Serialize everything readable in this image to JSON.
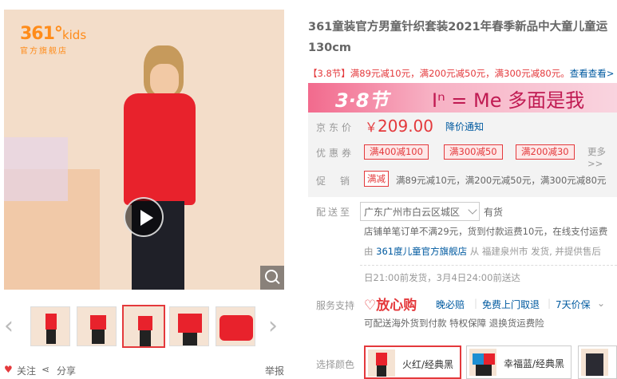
{
  "brand": {
    "logo_main": "361°",
    "logo_kids": "kids",
    "logo_sub": "官方旗舰店"
  },
  "gallery": {
    "prev_arrow": "‹",
    "next_arrow": "›",
    "thumbnails": [
      "thumb-1",
      "thumb-2",
      "thumb-3",
      "thumb-4",
      "thumb-5"
    ],
    "active_index": 2
  },
  "actions": {
    "follow": "关注",
    "share": "分享",
    "report": "举报"
  },
  "product": {
    "title": "361童装官方男童针织套装2021年春季新品中大童儿童运",
    "title_line2": "130cm",
    "promo_tag": "【3.8节】",
    "promo_text": "满89元减10元，满200元减50元，满300元减80元。",
    "promo_link": "查看查看>"
  },
  "banner": {
    "festival": "3·8节",
    "slogan": "Iⁿ = Me 多面是我"
  },
  "price": {
    "label": "京东价",
    "currency": "￥",
    "value": "209.00",
    "notice": "降价通知"
  },
  "coupons": {
    "label": "优惠券",
    "items": [
      "满400减100",
      "满300减50",
      "满200减30"
    ],
    "more": "更多>>"
  },
  "promotion": {
    "label": "促销",
    "tag": "满减",
    "text": "满89元减10元，满200元减50元，满300元减80元"
  },
  "shipping": {
    "label": "配送至",
    "region": "广东广州市白云区城区",
    "stock": "有货",
    "note": "店铺单笔订单不满29元，货到付款运费10元，在线支付运费",
    "seller_prefix": "由",
    "seller": "361度儿童官方旗舰店",
    "seller_suffix": "从 福建泉州市 发货, 并提供售后",
    "dispatch": "日21:00前发货，3月4日24:00前送达"
  },
  "service": {
    "label": "服务支持",
    "brand": "放心购",
    "items": [
      "晚必赔",
      "免费上门取退",
      "7天价保"
    ],
    "sub": "可配送海外货到付款 特权保障 退换货运费险"
  },
  "colors": {
    "label": "选择颜色",
    "options": [
      "火红/经典黑",
      "幸福蓝/经典黑",
      ""
    ],
    "selected_index": 0
  }
}
